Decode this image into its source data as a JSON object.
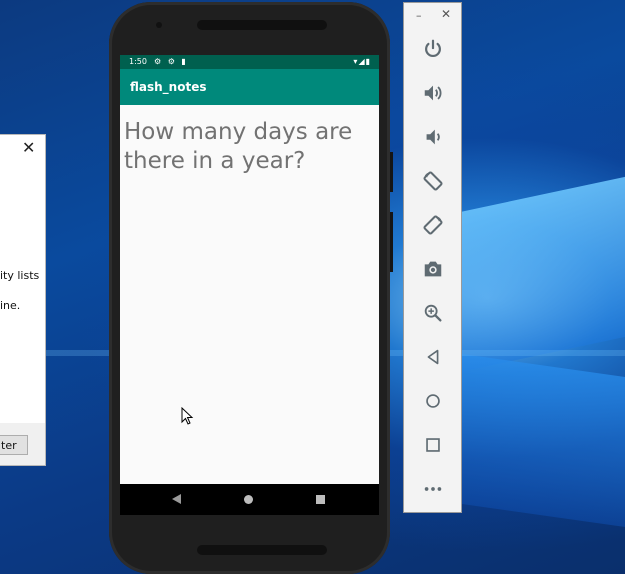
{
  "dialog": {
    "close_glyph": "✕",
    "text_line1": "ity lists",
    "text_line2": "ine.",
    "button_label": "ter"
  },
  "phone": {
    "status": {
      "time": "1:50",
      "left_icons": "⚙ ⚙ ▮",
      "right_icons": "▾◢▮"
    },
    "app_title": "flash_notes",
    "question": "How many days are there in a year?"
  },
  "emulator_toolbar": {
    "minimize_glyph": "–",
    "close_glyph": "✕",
    "buttons": [
      {
        "icon": "power-icon"
      },
      {
        "icon": "volume-up-icon"
      },
      {
        "icon": "volume-down-icon"
      },
      {
        "icon": "rotate-left-icon"
      },
      {
        "icon": "rotate-right-icon"
      },
      {
        "icon": "camera-icon"
      },
      {
        "icon": "zoom-icon"
      },
      {
        "icon": "back-icon"
      },
      {
        "icon": "home-icon"
      },
      {
        "icon": "overview-icon"
      },
      {
        "icon": "more-icon"
      }
    ]
  },
  "colors": {
    "app_bar": "#00897b",
    "status_bar": "#00604f",
    "toolbar_icon": "#5f6b72"
  }
}
